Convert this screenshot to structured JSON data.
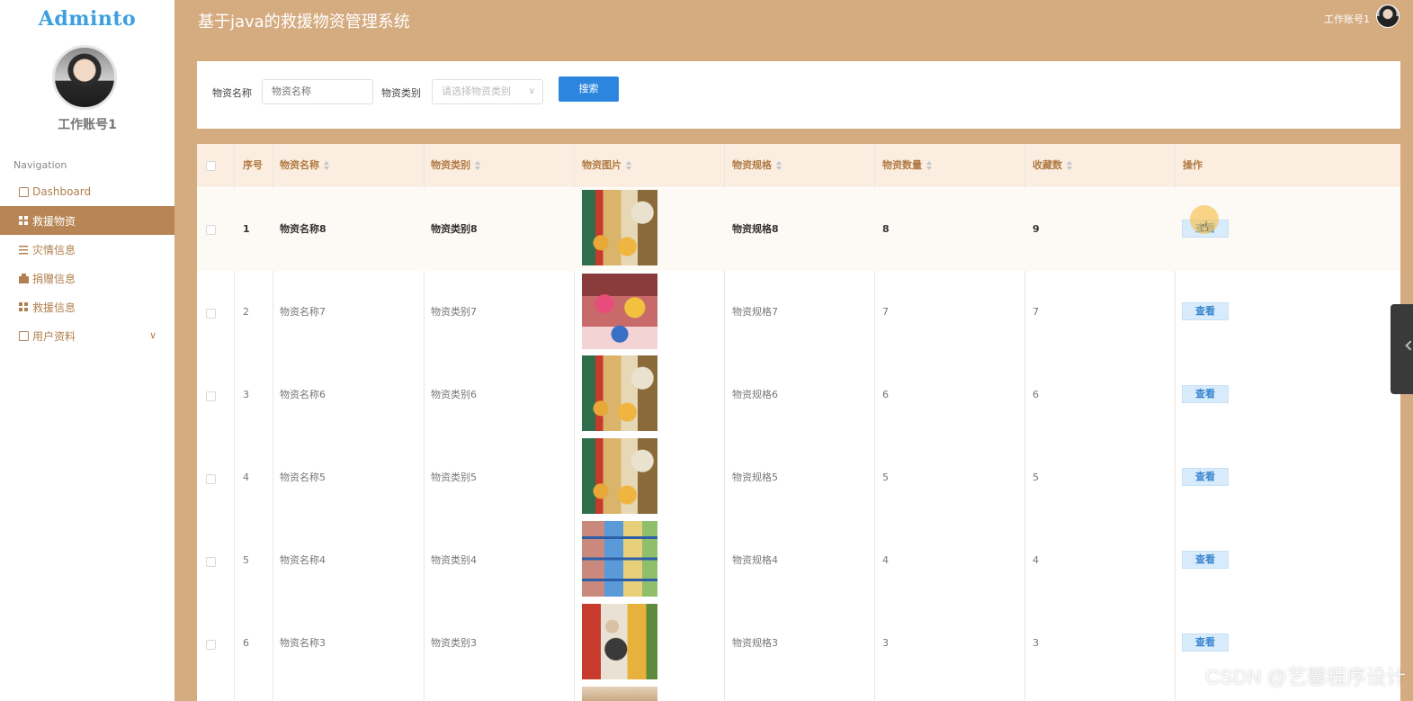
{
  "brand": {
    "logo": "Adminto"
  },
  "user": {
    "name": "工作账号1",
    "header_name": "工作账号1"
  },
  "header": {
    "title": "基于java的救援物资管理系统"
  },
  "nav": {
    "title": "Navigation",
    "items": [
      {
        "label": "Dashboard",
        "icon": "home-icon"
      },
      {
        "label": "救援物资",
        "icon": "grid-icon",
        "active": true
      },
      {
        "label": "灾情信息",
        "icon": "list-icon"
      },
      {
        "label": "捐赠信息",
        "icon": "bag-icon"
      },
      {
        "label": "救援信息",
        "icon": "grid-icon"
      },
      {
        "label": "用户资料",
        "icon": "card-icon",
        "has_children": true
      }
    ]
  },
  "search": {
    "name_label": "物资名称",
    "name_placeholder": "物资名称",
    "type_label": "物资类别",
    "type_placeholder": "请选择物资类别",
    "button": "搜索"
  },
  "table": {
    "columns": [
      "序号",
      "物资名称",
      "物资类别",
      "物资图片",
      "物资规格",
      "物资数量",
      "收藏数",
      "操作"
    ],
    "action_label": "查看",
    "rows": [
      {
        "index": "1",
        "name": "物资名称8",
        "type": "物资类别8",
        "spec": "物资规格8",
        "qty": "8",
        "fav": "9"
      },
      {
        "index": "2",
        "name": "物资名称7",
        "type": "物资类别7",
        "spec": "物资规格7",
        "qty": "7",
        "fav": "7"
      },
      {
        "index": "3",
        "name": "物资名称6",
        "type": "物资类别6",
        "spec": "物资规格6",
        "qty": "6",
        "fav": "6"
      },
      {
        "index": "4",
        "name": "物资名称5",
        "type": "物资类别5",
        "spec": "物资规格5",
        "qty": "5",
        "fav": "5"
      },
      {
        "index": "5",
        "name": "物资名称4",
        "type": "物资类别4",
        "spec": "物资规格4",
        "qty": "4",
        "fav": "4"
      },
      {
        "index": "6",
        "name": "物资名称3",
        "type": "物资类别3",
        "spec": "物资规格3",
        "qty": "3",
        "fav": "3"
      }
    ]
  },
  "watermark": "CSDN @艺馨程序设计",
  "colors": {
    "header_bg": "#d5ab80",
    "nav_active": "#b88554",
    "primary": "#2c86e0"
  }
}
